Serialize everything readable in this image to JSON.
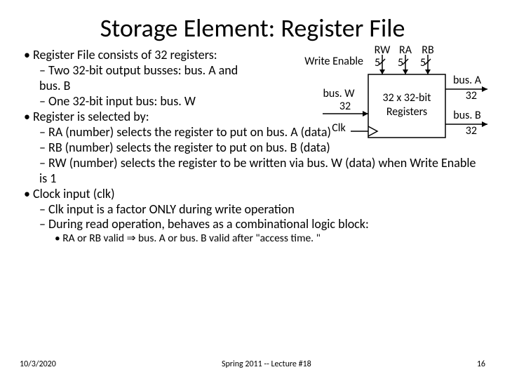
{
  "title": "Storage Element: Register File",
  "bullets": {
    "b1": "Register File consists of 32 registers:",
    "b1_1": "Two 32-bit output busses: bus. A and bus. B",
    "b1_2": "One 32-bit input bus: bus. W",
    "b2": "Register is selected by:",
    "b2_1": "RA (number) selects the register to put on bus. A (data)",
    "b2_2": "RB (number) selects the register to put on bus. B (data)",
    "b2_3": "RW (number) selects the register to be  written via bus. W (data) when Write Enable is 1",
    "b3": "Clock input (clk)",
    "b3_1": "Clk input is a factor ONLY during write operation",
    "b3_2": "During read operation, behaves as a combinational logic block:",
    "b3_2_1_pre": "RA or RB valid ",
    "b3_2_1_post": " bus. A or bus. B valid after \"access time. \""
  },
  "diagram": {
    "write_enable": "Write Enable",
    "rw": "RW",
    "ra": "RA",
    "rb": "RB",
    "five_1": "5",
    "five_2": "5",
    "five_3": "5",
    "busW": "bus. W",
    "busW32": "32",
    "clk": "Clk",
    "box1": "32 x 32-bit",
    "box2": "Registers",
    "busA": "bus. A",
    "busA32": "32",
    "busB": "bus. B",
    "busB32": "32"
  },
  "footer": {
    "date": "10/3/2020",
    "mid": "Spring 2011 -- Lecture #18",
    "page": "16"
  }
}
